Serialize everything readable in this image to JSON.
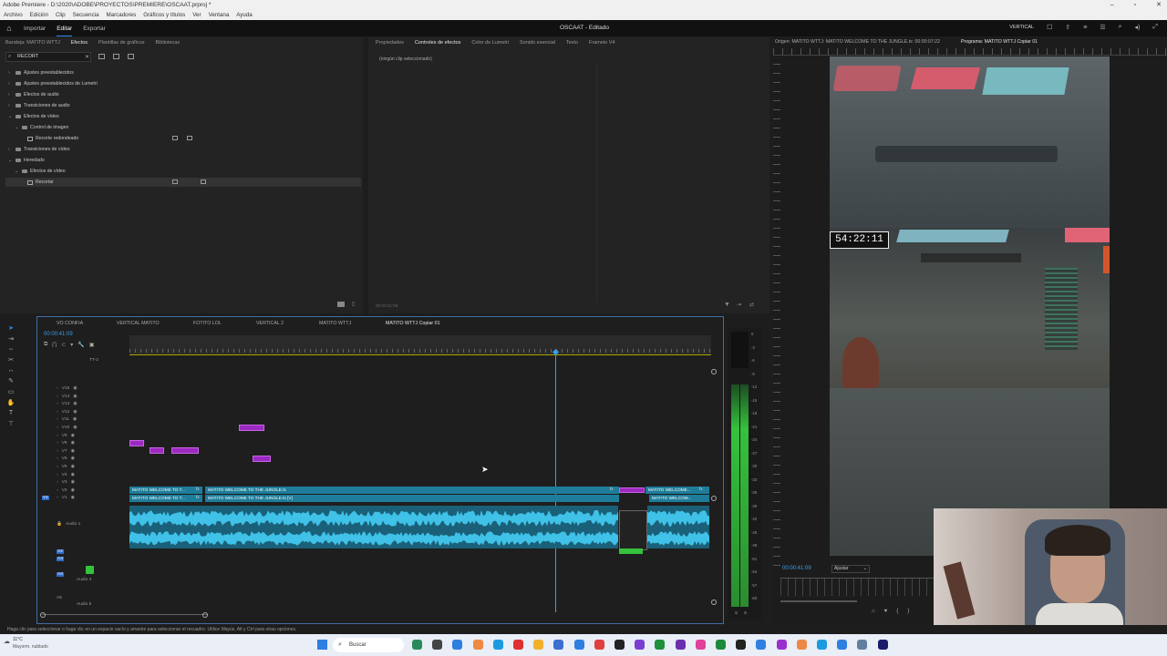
{
  "window": {
    "title": "Adobe Premiere - D:\\2020\\ADOBE\\PROYECTOS\\PREMIERE\\OSCAAT.prproj *",
    "menu": [
      "Archivo",
      "Edición",
      "Clip",
      "Secuencia",
      "Marcadores",
      "Gráficos y títulos",
      "Ver",
      "Ventana",
      "Ayuda"
    ]
  },
  "appbar": {
    "tabs": [
      "Importar",
      "Editar",
      "Exportar"
    ],
    "active_tab": "Editar",
    "project_title": "OSCAAT - Editado",
    "workspace": "VERTICAL"
  },
  "effects_panel": {
    "tabs": [
      "Bandeja: MATITO WTTJ",
      "Efectos",
      "Plantillas de gráficos",
      "Bibliotecas"
    ],
    "search_value": "RECORT",
    "tree": [
      {
        "label": "Ajustes preestablecidos",
        "level": 0,
        "open": false
      },
      {
        "label": "Ajustes preestablecidos de Lumetri",
        "level": 0,
        "open": false
      },
      {
        "label": "Efectos de audio",
        "level": 0,
        "open": false
      },
      {
        "label": "Transiciones de audio",
        "level": 0,
        "open": false
      },
      {
        "label": "Efectos de vídeo",
        "level": 0,
        "open": true
      },
      {
        "label": "Control de imagen",
        "level": 1,
        "open": true
      },
      {
        "label": "Recorte redondeado",
        "level": 2,
        "open": false
      },
      {
        "label": "Transiciones de vídeo",
        "level": 0,
        "open": false
      },
      {
        "label": "Heredado",
        "level": 0,
        "open": true
      },
      {
        "label": "Efectos de vídeo",
        "level": 1,
        "open": true
      },
      {
        "label": "Recortar",
        "level": 2,
        "open": false
      }
    ]
  },
  "effect_controls": {
    "tabs": [
      "Propiedades",
      "Controles de efectos",
      "Color de Lumetri",
      "Sonido esencial",
      "Texto",
      "Frameio V4"
    ],
    "empty_text": "(ningún clip seleccionado)",
    "timecode": "00:00:41:09"
  },
  "monitor": {
    "source_tab": "Origen: MATITO WTTJ: MATITO WELCOME TO THE JUNGLE.ts: 00:00:07:22",
    "program_tab": "Programa: MATITO WTTJ Copiar 01",
    "overlay_timer": "54:22:11",
    "timecode": "00:00:41:09",
    "fit": "Ajustar"
  },
  "timeline": {
    "sequences": [
      "VO CONFIA",
      "VERTICAL MATITO",
      "FOTITO LOL",
      "VERTICAL 2",
      "MATITO WTTJ",
      "MATITO WTTJ Copiar 01"
    ],
    "active_sequence": "MATITO WTTJ Copiar 01",
    "timecode": "00:00:41:09",
    "top_track": "TT-2",
    "video_tracks": [
      "V15",
      "V14",
      "V13",
      "V12",
      "V11",
      "V10",
      "V9",
      "V8",
      "V7",
      "V6",
      "V5",
      "V4",
      "V3",
      "V2",
      "V1"
    ],
    "audio_tracks": [
      {
        "id": "A1",
        "name": "Audio 1"
      },
      {
        "id": "A2",
        "name": ""
      },
      {
        "id": "A3",
        "name": ""
      },
      {
        "id": "A4",
        "name": "Audio 4"
      },
      {
        "id": "A5",
        "name": "Audio 5"
      }
    ],
    "clip_labels": {
      "v2_a": "MATITO WELCOME TO T...",
      "v2_b": "MATITO WELCOME TO THE JUNGLE.ts",
      "v2_c": "MATITO WELCOME...",
      "v1_a": "MATITO WELCOME TO T...",
      "v1_b": "MATITO WELCOME TO THE JUNGLE.ts [V]",
      "v1_c": "MATITO WELCOM..."
    },
    "fx_label": "fx"
  },
  "meters": {
    "scale": [
      "0",
      "-3",
      "-6",
      "-9",
      "-12",
      "-15",
      "-18",
      "-21",
      "-24",
      "-27",
      "-30",
      "-33",
      "-36",
      "-39",
      "-42",
      "-45",
      "-48",
      "-51",
      "-54",
      "-57",
      "-60"
    ],
    "solo": [
      "S",
      "S"
    ]
  },
  "status_bar": "Haga clic para seleccionar o haga clic en un espacio vacío y arrastre para seleccionar el recuadro. Utilice Mayús, Alt y Ctrl para otras opciones.",
  "taskbar": {
    "weather_temp": "11°C",
    "weather_desc": "Mayorm. nublado",
    "search_placeholder": "Buscar"
  },
  "colors": {
    "accent": "#2d8ceb",
    "clip_purple": "#9c29c0",
    "clip_teal": "#1e7d9a",
    "audio_wave": "#3fc1e8",
    "meter_green": "#35c23d"
  }
}
